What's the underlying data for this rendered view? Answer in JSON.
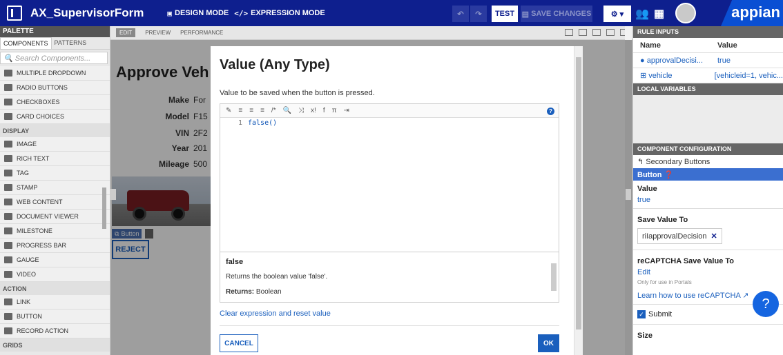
{
  "topbar": {
    "app_title": "AX_SupervisorForm",
    "design_mode_label": "DESIGN MODE",
    "expression_mode_label": "EXPRESSION MODE",
    "test_label": "TEST",
    "save_changes_label": "SAVE CHANGES",
    "brand": "appian"
  },
  "palette": {
    "header": "PALETTE",
    "tabs": [
      "COMPONENTS",
      "PATTERNS"
    ],
    "search_placeholder": "Search Components...",
    "items_top": [
      "MULTIPLE DROPDOWN",
      "RADIO BUTTONS",
      "CHECKBOXES",
      "CARD CHOICES"
    ],
    "group_display": "DISPLAY",
    "items_display": [
      "IMAGE",
      "RICH TEXT",
      "TAG",
      "STAMP",
      "WEB CONTENT",
      "DOCUMENT VIEWER",
      "MILESTONE",
      "PROGRESS BAR",
      "GAUGE",
      "VIDEO"
    ],
    "group_action": "ACTION",
    "items_action": [
      "LINK",
      "BUTTON",
      "RECORD ACTION"
    ],
    "group_grids": "GRIDS"
  },
  "canvas": {
    "tab_edit": "EDIT",
    "tab_preview": "PREVIEW",
    "tab_performance": "PERFORMANCE",
    "form_title": "Approve Veh",
    "fields": [
      {
        "label": "Make",
        "value": "For"
      },
      {
        "label": "Model",
        "value": "F15"
      },
      {
        "label": "VIN",
        "value": "2F2"
      },
      {
        "label": "Year",
        "value": "201"
      },
      {
        "label": "Mileage",
        "value": "500"
      }
    ],
    "button_tag": "Button",
    "reject_label": "REJECT"
  },
  "modal": {
    "title": "Value (Any Type)",
    "description": "Value to be saved when the button is pressed.",
    "toolbar_glyphs": [
      "✎",
      "≡",
      "≡",
      "≡",
      "/*",
      "🔍",
      "⤨",
      "x!",
      "f",
      "π",
      "⇥"
    ],
    "line_number": "1",
    "code": "false()",
    "doc_name": "false",
    "doc_description": "Returns the boolean value 'false'.",
    "doc_returns_label": "Returns:",
    "doc_returns_value": "Boolean",
    "clear_link": "Clear expression and reset value",
    "cancel_label": "CANCEL",
    "ok_label": "OK"
  },
  "rpanel": {
    "rule_inputs_header": "RULE INPUTS",
    "col_name": "Name",
    "col_value": "Value",
    "rule_inputs": [
      {
        "name": "approvalDecisi...",
        "value": "true"
      },
      {
        "name": "vehicle",
        "value": "[vehicleid=1, vehic..."
      }
    ],
    "local_variables_header": "LOCAL VARIABLES",
    "component_config_header": "COMPONENT CONFIGURATION",
    "breadcrumb": "Secondary Buttons",
    "button_header": "Button",
    "value_label": "Value",
    "value_value": "true",
    "save_value_to_label": "Save Value To",
    "save_value_chip": "riIapprovalDecision",
    "recaptcha_label": "reCAPTCHA Save Value To",
    "recaptcha_edit": "Edit",
    "recaptcha_note": "Only for use in Portals",
    "recaptcha_learn": "Learn how to use reCAPTCHA",
    "submit_label": "Submit",
    "size_label": "Size"
  }
}
